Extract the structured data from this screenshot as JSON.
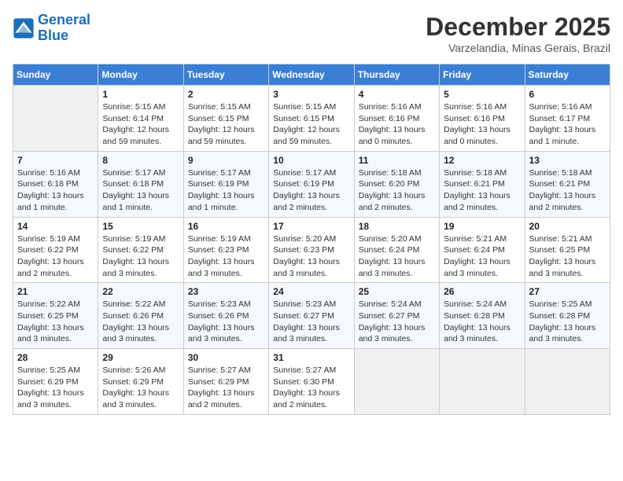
{
  "header": {
    "logo_line1": "General",
    "logo_line2": "Blue",
    "month": "December 2025",
    "location": "Varzelandia, Minas Gerais, Brazil"
  },
  "weekdays": [
    "Sunday",
    "Monday",
    "Tuesday",
    "Wednesday",
    "Thursday",
    "Friday",
    "Saturday"
  ],
  "weeks": [
    [
      {
        "day": "",
        "info": ""
      },
      {
        "day": "1",
        "info": "Sunrise: 5:15 AM\nSunset: 6:14 PM\nDaylight: 12 hours\nand 59 minutes."
      },
      {
        "day": "2",
        "info": "Sunrise: 5:15 AM\nSunset: 6:15 PM\nDaylight: 12 hours\nand 59 minutes."
      },
      {
        "day": "3",
        "info": "Sunrise: 5:15 AM\nSunset: 6:15 PM\nDaylight: 12 hours\nand 59 minutes."
      },
      {
        "day": "4",
        "info": "Sunrise: 5:16 AM\nSunset: 6:16 PM\nDaylight: 13 hours\nand 0 minutes."
      },
      {
        "day": "5",
        "info": "Sunrise: 5:16 AM\nSunset: 6:16 PM\nDaylight: 13 hours\nand 0 minutes."
      },
      {
        "day": "6",
        "info": "Sunrise: 5:16 AM\nSunset: 6:17 PM\nDaylight: 13 hours\nand 1 minute."
      }
    ],
    [
      {
        "day": "7",
        "info": "Sunrise: 5:16 AM\nSunset: 6:18 PM\nDaylight: 13 hours\nand 1 minute."
      },
      {
        "day": "8",
        "info": "Sunrise: 5:17 AM\nSunset: 6:18 PM\nDaylight: 13 hours\nand 1 minute."
      },
      {
        "day": "9",
        "info": "Sunrise: 5:17 AM\nSunset: 6:19 PM\nDaylight: 13 hours\nand 1 minute."
      },
      {
        "day": "10",
        "info": "Sunrise: 5:17 AM\nSunset: 6:19 PM\nDaylight: 13 hours\nand 2 minutes."
      },
      {
        "day": "11",
        "info": "Sunrise: 5:18 AM\nSunset: 6:20 PM\nDaylight: 13 hours\nand 2 minutes."
      },
      {
        "day": "12",
        "info": "Sunrise: 5:18 AM\nSunset: 6:21 PM\nDaylight: 13 hours\nand 2 minutes."
      },
      {
        "day": "13",
        "info": "Sunrise: 5:18 AM\nSunset: 6:21 PM\nDaylight: 13 hours\nand 2 minutes."
      }
    ],
    [
      {
        "day": "14",
        "info": "Sunrise: 5:19 AM\nSunset: 6:22 PM\nDaylight: 13 hours\nand 2 minutes."
      },
      {
        "day": "15",
        "info": "Sunrise: 5:19 AM\nSunset: 6:22 PM\nDaylight: 13 hours\nand 3 minutes."
      },
      {
        "day": "16",
        "info": "Sunrise: 5:19 AM\nSunset: 6:23 PM\nDaylight: 13 hours\nand 3 minutes."
      },
      {
        "day": "17",
        "info": "Sunrise: 5:20 AM\nSunset: 6:23 PM\nDaylight: 13 hours\nand 3 minutes."
      },
      {
        "day": "18",
        "info": "Sunrise: 5:20 AM\nSunset: 6:24 PM\nDaylight: 13 hours\nand 3 minutes."
      },
      {
        "day": "19",
        "info": "Sunrise: 5:21 AM\nSunset: 6:24 PM\nDaylight: 13 hours\nand 3 minutes."
      },
      {
        "day": "20",
        "info": "Sunrise: 5:21 AM\nSunset: 6:25 PM\nDaylight: 13 hours\nand 3 minutes."
      }
    ],
    [
      {
        "day": "21",
        "info": "Sunrise: 5:22 AM\nSunset: 6:25 PM\nDaylight: 13 hours\nand 3 minutes."
      },
      {
        "day": "22",
        "info": "Sunrise: 5:22 AM\nSunset: 6:26 PM\nDaylight: 13 hours\nand 3 minutes."
      },
      {
        "day": "23",
        "info": "Sunrise: 5:23 AM\nSunset: 6:26 PM\nDaylight: 13 hours\nand 3 minutes."
      },
      {
        "day": "24",
        "info": "Sunrise: 5:23 AM\nSunset: 6:27 PM\nDaylight: 13 hours\nand 3 minutes."
      },
      {
        "day": "25",
        "info": "Sunrise: 5:24 AM\nSunset: 6:27 PM\nDaylight: 13 hours\nand 3 minutes."
      },
      {
        "day": "26",
        "info": "Sunrise: 5:24 AM\nSunset: 6:28 PM\nDaylight: 13 hours\nand 3 minutes."
      },
      {
        "day": "27",
        "info": "Sunrise: 5:25 AM\nSunset: 6:28 PM\nDaylight: 13 hours\nand 3 minutes."
      }
    ],
    [
      {
        "day": "28",
        "info": "Sunrise: 5:25 AM\nSunset: 6:29 PM\nDaylight: 13 hours\nand 3 minutes."
      },
      {
        "day": "29",
        "info": "Sunrise: 5:26 AM\nSunset: 6:29 PM\nDaylight: 13 hours\nand 3 minutes."
      },
      {
        "day": "30",
        "info": "Sunrise: 5:27 AM\nSunset: 6:29 PM\nDaylight: 13 hours\nand 2 minutes."
      },
      {
        "day": "31",
        "info": "Sunrise: 5:27 AM\nSunset: 6:30 PM\nDaylight: 13 hours\nand 2 minutes."
      },
      {
        "day": "",
        "info": ""
      },
      {
        "day": "",
        "info": ""
      },
      {
        "day": "",
        "info": ""
      }
    ]
  ]
}
